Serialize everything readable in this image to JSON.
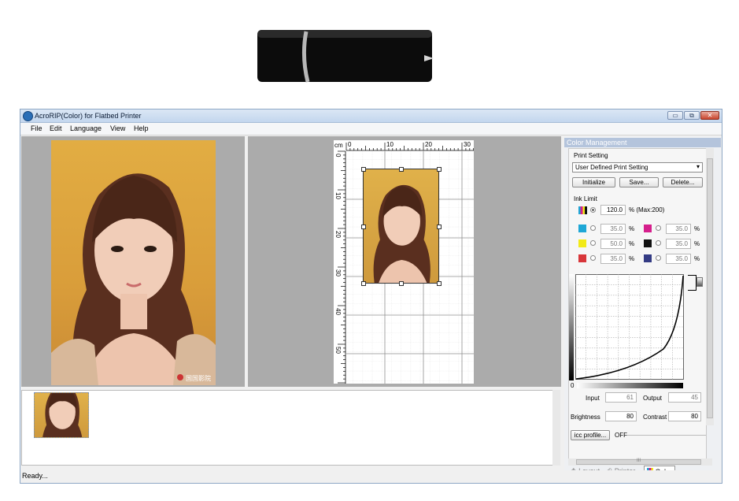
{
  "window": {
    "title": "AcroRIP(Color) for Flatbed Printer",
    "controls": {
      "minimize": "▭",
      "maximize": "⧉",
      "close": "✕"
    }
  },
  "menu": [
    "File",
    "Edit",
    "Language",
    "View",
    "Help"
  ],
  "ruler": {
    "unit": "cm",
    "top_ticks": [
      "0",
      "10",
      "20",
      "30"
    ],
    "left_ticks": [
      "0",
      "10",
      "20",
      "30",
      "40",
      "50"
    ]
  },
  "photo_watermark": "国国影院",
  "color_management": {
    "header": "Color Management",
    "print_setting_label": "Print Setting",
    "print_setting_value": "User Defined Print Setting",
    "buttons": {
      "initialize": "Initialize",
      "save": "Save...",
      "delete": "Delete..."
    },
    "ink_limit_label": "Ink Limit",
    "ink_limit_value": "120.0",
    "ink_limit_max": "% (Max:200)",
    "inks": [
      {
        "color": "#1ea7d6",
        "value": "35.0"
      },
      {
        "color": "#d51f8c",
        "value": "35.0"
      },
      {
        "color": "#f2ea17",
        "value": "50.0"
      },
      {
        "color": "#111111",
        "value": "35.0"
      },
      {
        "color": "#d8363a",
        "value": "35.0"
      },
      {
        "color": "#343b84",
        "value": "35.0"
      }
    ],
    "pct_sign": "%",
    "curve_zero": "0",
    "input_label": "Input",
    "input_value": "61",
    "output_label": "Output",
    "output_value": "45",
    "brightness_label": "Brightness",
    "brightness_value": "80",
    "contrast_label": "Contrast",
    "contrast_value": "80",
    "icc_button": "icc profile...",
    "icc_state": "OFF",
    "scroll_mark": "III"
  },
  "tabs": {
    "layout": "Layout",
    "printer": "Printer",
    "color": "Color"
  },
  "status": "Ready..."
}
